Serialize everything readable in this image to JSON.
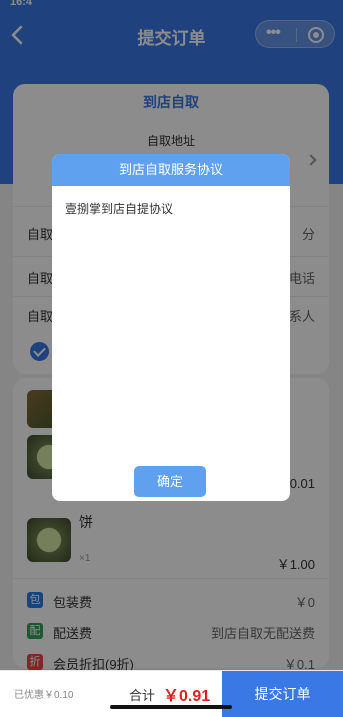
{
  "status_bar": {
    "time": "16:4"
  },
  "nav": {
    "title": "提交订单",
    "more_icon": "•••",
    "target_icon": "record-icon"
  },
  "order": {
    "mode_tab": "到店自取",
    "address_label": "自取地址",
    "rows": [
      {
        "label": "自取",
        "right": "分"
      },
      {
        "label": "自取",
        "right": "电话"
      },
      {
        "label": "自取",
        "right": "系人"
      }
    ]
  },
  "goods": {
    "items": [
      {
        "name": "",
        "qty": "",
        "price": ""
      },
      {
        "name": "",
        "qty": "",
        "price": "￥0.01"
      },
      {
        "name": "饼",
        "qty": "×1",
        "price": "￥1.00"
      }
    ],
    "fees": [
      {
        "icon": "包",
        "label": "包装费",
        "value": "￥0",
        "color": "#2f7be8"
      },
      {
        "icon": "配",
        "label": "配送费",
        "value": "到店自取无配送费",
        "color": "#33a35a"
      },
      {
        "icon": "折",
        "label": "会员折扣(9折)",
        "value": "￥0.1",
        "color": "#e24a4a"
      }
    ]
  },
  "modal": {
    "title": "到店自取服务协议",
    "body": "壹捌掌到店自提协议",
    "confirm": "确定"
  },
  "bottom": {
    "discount": "已优惠￥0.10",
    "total_label": "合计",
    "total_value": "￥0.91",
    "submit": "提交订单"
  },
  "colors": {
    "primary": "#3a78e6",
    "modal_accent": "#5fa0ef",
    "price_red": "#e02020"
  }
}
